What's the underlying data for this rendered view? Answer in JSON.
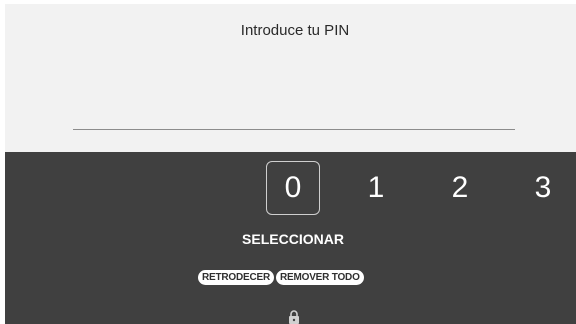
{
  "pin_entry": {
    "prompt": "Introduce tu PIN"
  },
  "keypad": {
    "digits": [
      "0",
      "1",
      "2",
      "3"
    ],
    "selected_digit": "0",
    "select_label": "SELECCIONAR",
    "back_label": "RETRODECER",
    "clear_label": "REMOVER TODO",
    "footer_icon": "lock-icon"
  },
  "colors": {
    "top_background": "#f2f2f2",
    "keypad_background": "#404040",
    "text_light": "#ffffff",
    "text_dark": "#2a2a2a"
  }
}
